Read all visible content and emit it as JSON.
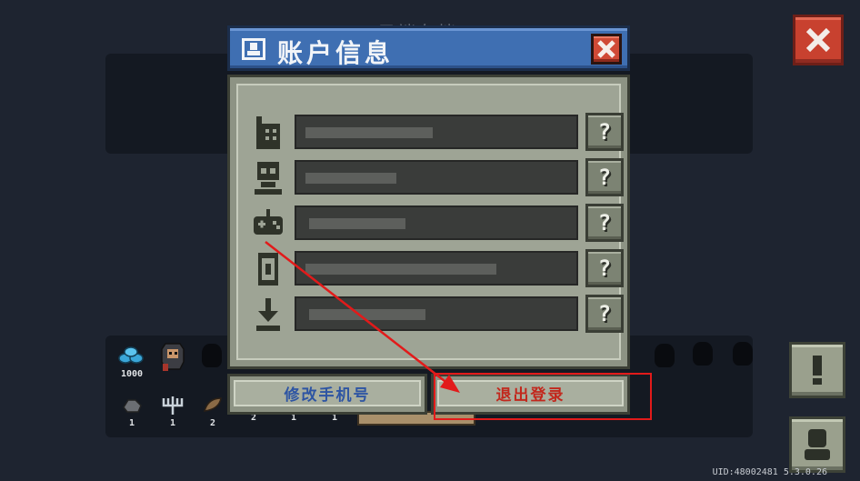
{
  "background": {
    "title": "云端存档"
  },
  "dialog": {
    "title": "账户信息",
    "rows": [
      {
        "icon": "phone-icon"
      },
      {
        "icon": "skull-icon"
      },
      {
        "icon": "gamepad-icon"
      },
      {
        "icon": "tablet-icon"
      },
      {
        "icon": "download-icon"
      }
    ],
    "help_label": "?",
    "change_phone_label": "修改手机号",
    "logout_label": "退出登录"
  },
  "inventory": {
    "gems_count": "1000",
    "items": [
      {
        "icon": "ore-icon",
        "count": "1"
      },
      {
        "icon": "trident-icon",
        "count": "1"
      },
      {
        "icon": "leaf-icon",
        "count": "2"
      },
      {
        "icon": "wing-icon",
        "count": "2"
      },
      {
        "icon": "item-icon",
        "count": "1"
      },
      {
        "icon": "item-icon",
        "count": "1"
      }
    ]
  },
  "uid_text": "UID:48002481 5.3.0.26",
  "colors": {
    "header_blue": "#3f6fb2",
    "panel_gray": "#9ea495",
    "close_red": "#c8412f",
    "highlight_red": "#e21a1a",
    "change_phone_text": "#2e55a3",
    "logout_text": "#c2281d"
  }
}
